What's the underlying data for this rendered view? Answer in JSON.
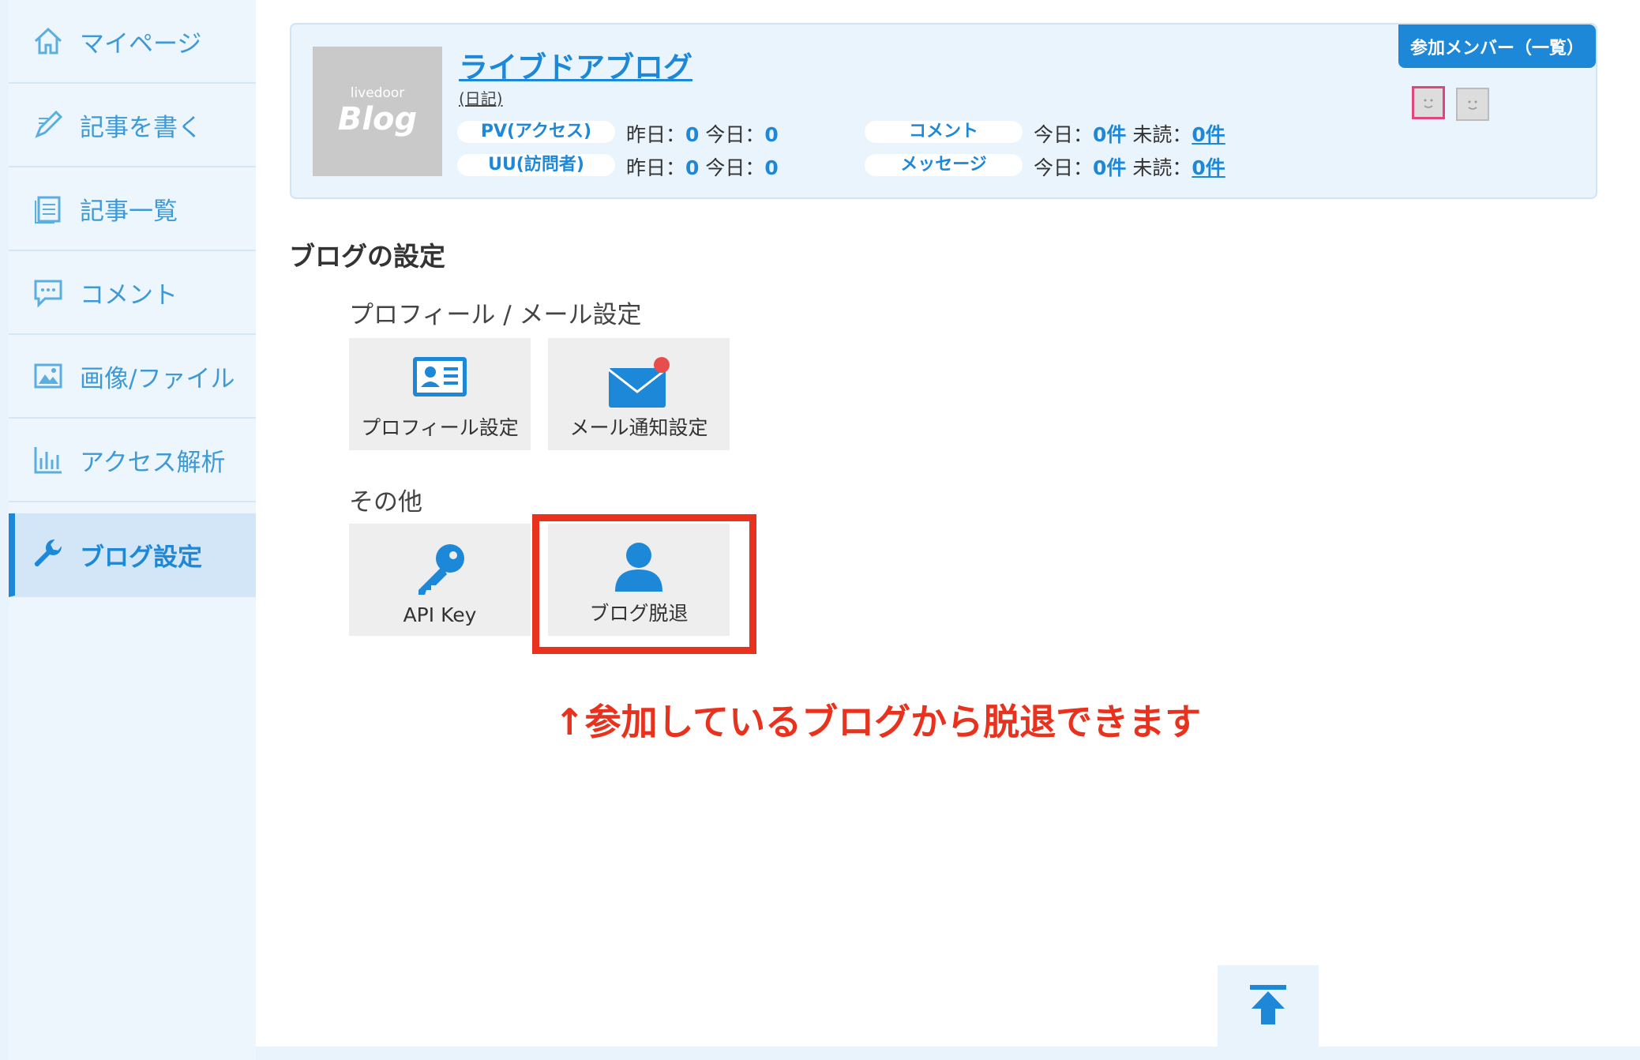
{
  "sidebar": {
    "items": [
      {
        "label": "マイページ",
        "icon": "home-icon"
      },
      {
        "label": "記事を書く",
        "icon": "pencil-icon"
      },
      {
        "label": "記事一覧",
        "icon": "document-list-icon"
      },
      {
        "label": "コメント",
        "icon": "comment-icon"
      },
      {
        "label": "画像/ファイル",
        "icon": "image-icon"
      },
      {
        "label": "アクセス解析",
        "icon": "bar-chart-icon"
      },
      {
        "label": "ブログ設定",
        "icon": "wrench-icon",
        "active": true
      }
    ]
  },
  "blog_card": {
    "thumb_small": "livedoor",
    "thumb_big": "Blog",
    "title": "ライブドアブログ",
    "subtitle": "(日記)",
    "members_button": "参加メンバー（一覧）",
    "pv_label": "PV(アクセス)",
    "pv_yesterday_label": "昨日：",
    "pv_yesterday": "0",
    "pv_today_label": "今日：",
    "pv_today": "0",
    "uu_label": "UU(訪問者)",
    "uu_yesterday_label": "昨日：",
    "uu_yesterday": "0",
    "uu_today_label": "今日：",
    "uu_today": "0",
    "comment_label": "コメント",
    "comment_today_label": "今日：",
    "comment_today": "0件",
    "comment_unread_label": "未読：",
    "comment_unread": "0件",
    "message_label": "メッセージ",
    "message_today_label": "今日：",
    "message_today": "0件",
    "message_unread_label": "未読：",
    "message_unread": "0件"
  },
  "settings": {
    "title": "ブログの設定",
    "group1_title": "プロフィール / メール設定",
    "profile_tile": "プロフィール設定",
    "mail_tile": "メール通知設定",
    "group2_title": "その他",
    "api_tile": "API Key",
    "leave_tile": "ブログ脱退"
  },
  "annotation": "↑参加しているブログから脱退できます",
  "colors": {
    "accent": "#1e88d8",
    "highlight": "#e8321e"
  }
}
